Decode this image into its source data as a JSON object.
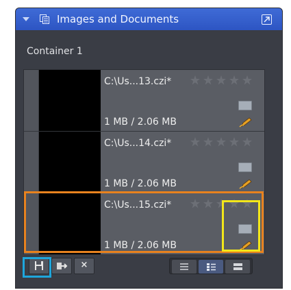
{
  "panel": {
    "title": "Images and Documents",
    "icons": {
      "collapse": "chevron-down-icon",
      "images": "documents-stack-icon",
      "popout": "popout-window-icon"
    }
  },
  "container": {
    "label": "Container 1"
  },
  "items": [
    {
      "name": "C:\\Us...13.czi*",
      "size": "1 MB / 2.06 MB",
      "rating": 0,
      "max_rating": 5
    },
    {
      "name": "C:\\Us...14.czi*",
      "size": "1 MB / 2.06 MB",
      "rating": 0,
      "max_rating": 5
    },
    {
      "name": "C:\\Us...15.czi*",
      "size": "1 MB / 2.06 MB",
      "rating": 0,
      "max_rating": 5
    }
  ],
  "toolbar": {
    "left": [
      "save-icon",
      "move-to-icon",
      "close-icon"
    ],
    "close_glyph": "×",
    "view_modes": [
      "list-view-icon",
      "details-view-icon",
      "compact-view-icon"
    ],
    "active_view": "details"
  },
  "highlights": {
    "orange": "#e8821e",
    "yellow": "#f3e71a",
    "blue": "#1ea6dc"
  },
  "colors": {
    "titlebar": "#2d55c3",
    "panel_bg": "#3a3d45",
    "item_bg": "#5a5d64"
  }
}
